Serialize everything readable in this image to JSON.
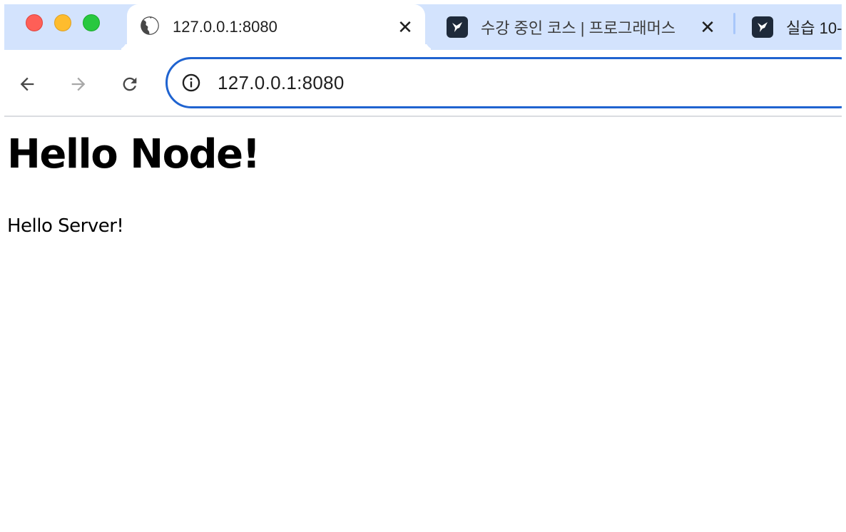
{
  "browser": {
    "tabs": [
      {
        "title": "127.0.0.1:8080",
        "favicon": "globe-icon",
        "active": true
      },
      {
        "title": "수강 중인 코스 | 프로그래머스",
        "favicon": "programmers-logo-icon",
        "active": false
      },
      {
        "title": "실습 10-",
        "favicon": "programmers-logo-icon",
        "active": false
      }
    ],
    "close_symbol": "✕",
    "address_bar": {
      "url": "127.0.0.1:8080"
    }
  },
  "page": {
    "heading": "Hello Node!",
    "paragraph": "Hello Server!"
  },
  "colors": {
    "tabstrip_bg": "#d3e3fd",
    "omnibox_border": "#1f63d0"
  }
}
